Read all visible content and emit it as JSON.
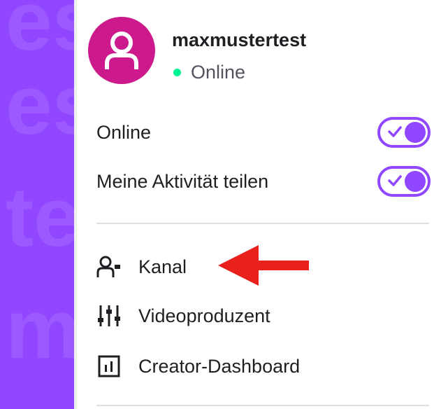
{
  "background_channel": {
    "ghost_text": [
      "est",
      "te",
      "mu"
    ],
    "color": "#9147ff"
  },
  "user": {
    "username": "maxmustertest",
    "status": "Online",
    "avatar_color": "#cc1a8c",
    "status_color": "#00f593"
  },
  "toggles": [
    {
      "label": "Online",
      "on": true
    },
    {
      "label": "Meine Aktivität teilen",
      "on": true
    }
  ],
  "nav": [
    {
      "label": "Kanal",
      "icon": "channel-person-icon"
    },
    {
      "label": "Videoproduzent",
      "icon": "sliders-icon"
    },
    {
      "label": "Creator-Dashboard",
      "icon": "dashboard-chart-icon"
    }
  ],
  "annotation": {
    "arrow_color": "#e8221b",
    "points_to": "Kanal"
  }
}
